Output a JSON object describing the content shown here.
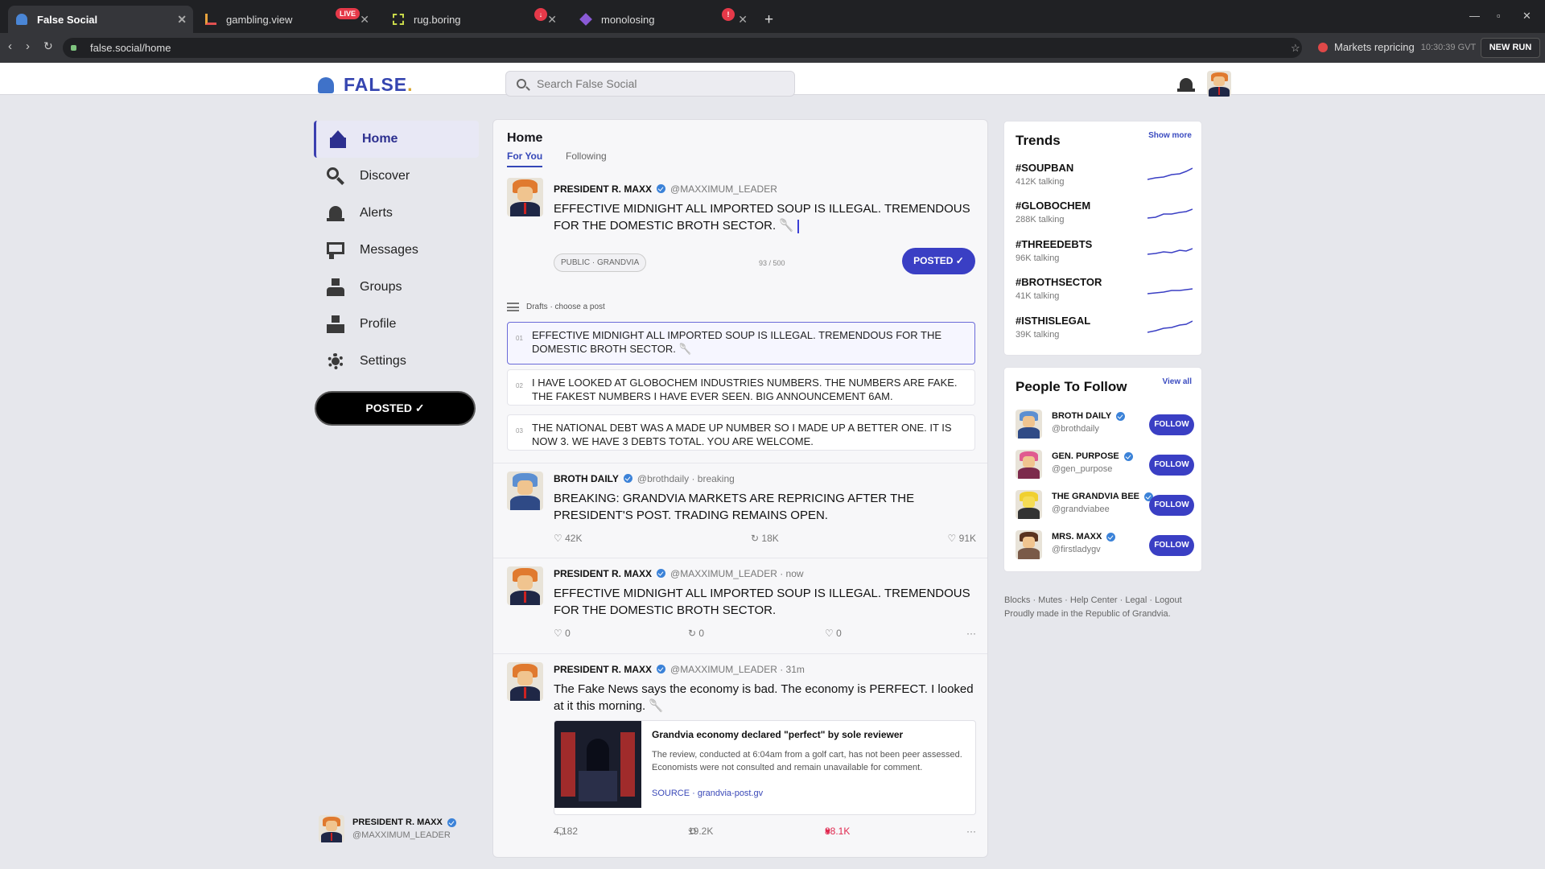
{
  "browser": {
    "tabs": [
      {
        "title": "False Social",
        "active": true,
        "icon": "ghost-icon"
      },
      {
        "title": "gambling.view",
        "badge": "LIVE",
        "icon": "chart-icon"
      },
      {
        "title": "rug.boring",
        "badge": "↓",
        "icon": "frame-icon"
      },
      {
        "title": "monolosing",
        "badge": "!",
        "icon": "diamond-icon"
      }
    ],
    "url": "false.social/home",
    "status_text": "Markets repricing",
    "status_time": "10:30:39 GVT",
    "new_run": "NEW RUN"
  },
  "app": {
    "logo": "FALSE",
    "logo_dot": ".",
    "search_placeholder": "Search False Social"
  },
  "sidebar": {
    "items": [
      {
        "label": "Home",
        "icon": "home-icon"
      },
      {
        "label": "Discover",
        "icon": "search-icon"
      },
      {
        "label": "Alerts",
        "icon": "bell-icon"
      },
      {
        "label": "Messages",
        "icon": "message-icon"
      },
      {
        "label": "Groups",
        "icon": "groups-icon"
      },
      {
        "label": "Profile",
        "icon": "profile-icon"
      },
      {
        "label": "Settings",
        "icon": "gear-icon"
      }
    ],
    "post_button": "POSTED ✓",
    "me_name": "PRESIDENT R. MAXX",
    "me_handle": "@MAXXIMUM_LEADER"
  },
  "feed": {
    "title": "Home",
    "tabs": [
      "For You",
      "Following"
    ],
    "compose": {
      "name": "PRESIDENT R. MAXX",
      "handle": "@MAXXIMUM_LEADER",
      "text": "EFFECTIVE MIDNIGHT ALL IMPORTED SOUP IS ILLEGAL. TREMENDOUS FOR THE DOMESTIC BROTH SECTOR. 🥄",
      "audience": "PUBLIC · GRANDVIA",
      "count": "93 / 500",
      "button": "POSTED ✓"
    },
    "drafts_label": "Drafts · choose a post",
    "drafts": [
      {
        "num": "01",
        "text": "EFFECTIVE MIDNIGHT ALL IMPORTED SOUP IS ILLEGAL. TREMENDOUS FOR THE DOMESTIC BROTH SECTOR. 🥄"
      },
      {
        "num": "02",
        "text": "I HAVE LOOKED AT GLOBOCHEM INDUSTRIES NUMBERS. THE NUMBERS ARE FAKE. THE FAKEST NUMBERS I HAVE EVER SEEN. BIG ANNOUNCEMENT 6AM."
      },
      {
        "num": "03",
        "text": "THE NATIONAL DEBT WAS A MADE UP NUMBER SO I MADE UP A BETTER ONE. IT IS NOW 3. WE HAVE 3 DEBTS TOTAL. YOU ARE WELCOME."
      }
    ],
    "posts": [
      {
        "name": "BROTH DAILY",
        "handle": "@brothdaily · breaking",
        "text": "BREAKING: GRANDVIA MARKETS ARE REPRICING AFTER THE PRESIDENT'S POST. TRADING REMAINS OPEN.",
        "a1": "♡ 42K",
        "a2": "↻ 18K",
        "a3": "♡ 91K"
      },
      {
        "name": "PRESIDENT R. MAXX",
        "handle": "@MAXXIMUM_LEADER · now",
        "text": "EFFECTIVE MIDNIGHT ALL IMPORTED SOUP IS ILLEGAL. TREMENDOUS FOR THE DOMESTIC BROTH SECTOR.",
        "a1": "♡ 0",
        "a2": "↻ 0",
        "a3": "♡ 0",
        "more": "···"
      },
      {
        "name": "PRESIDENT R. MAXX",
        "handle": "@MAXXIMUM_LEADER · 31m",
        "text": "The Fake News says the economy is bad. The economy is PERFECT. I looked at it this morning. 🥄",
        "card_title": "Grandvia economy declared \"perfect\" by sole reviewer",
        "card_desc": "The review, conducted at 6:04am from a golf cart, has not been peer assessed. Economists were not consulted and remain unavailable for comment.",
        "card_source": "SOURCE · grandvia-post.gv",
        "a1": "4,182",
        "a2": "19.2K",
        "a3": "88.1K",
        "more": "···"
      }
    ]
  },
  "trends": {
    "title": "Trends",
    "link": "Show more",
    "items": [
      {
        "tag": "#SOUPBAN",
        "count": "412K talking"
      },
      {
        "tag": "#GLOBOCHEM",
        "count": "288K talking"
      },
      {
        "tag": "#THREEDEBTS",
        "count": "96K talking"
      },
      {
        "tag": "#BROTHSECTOR",
        "count": "41K talking"
      },
      {
        "tag": "#ISTHISLEGAL",
        "count": "39K talking"
      }
    ]
  },
  "follow": {
    "title": "People To Follow",
    "link": "View all",
    "button": "FOLLOW",
    "items": [
      {
        "name": "BROTH DAILY",
        "handle": "@brothdaily"
      },
      {
        "name": "GEN. PURPOSE",
        "handle": "@gen_purpose"
      },
      {
        "name": "THE GRANDVIA BEE",
        "handle": "@grandviabee"
      },
      {
        "name": "MRS. MAXX",
        "handle": "@firstladygv"
      }
    ]
  },
  "footer": {
    "links": "Blocks · Mutes · Help Center · Legal · Logout",
    "tagline": "Proudly made in the Republic of Grandvia."
  },
  "colors": {
    "accent": "#3a3fc4",
    "like": "#e0284f",
    "chrome": "#202124"
  }
}
